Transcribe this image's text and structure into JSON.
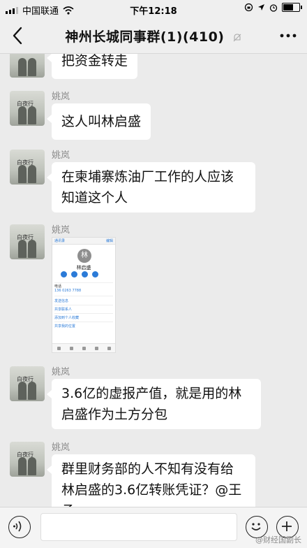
{
  "status_bar": {
    "carrier": "中国联通",
    "time": "下午12:18"
  },
  "nav": {
    "title": "神州长城同事群(1)(410)"
  },
  "avatar_text": "白夜行",
  "messages": [
    {
      "sender": "",
      "text": "把资金转走"
    },
    {
      "sender": "姚岚",
      "text": "这人叫林启盛"
    },
    {
      "sender": "姚岚",
      "lines": [
        "在柬埔寨炼油厂工作的人应该",
        "知道这个人"
      ]
    },
    {
      "sender": "姚岚",
      "type": "image",
      "card": {
        "back": "通讯录",
        "edit": "编辑",
        "initial": "林",
        "name": "林启盛",
        "section": "电话",
        "phone": "136 0263 7788",
        "links": [
          "发送信息",
          "共享联系人",
          "添加到个人收藏",
          "共享我的位置"
        ]
      }
    },
    {
      "sender": "姚岚",
      "lines": [
        "3.6亿的虚报产值，就是用的林",
        "启盛作为土方分包"
      ]
    },
    {
      "sender": "姚岚",
      "lines": [
        "群里财务部的人不知有没有给",
        "林启盛的3.6亿转账凭证？@王",
        "承"
      ]
    }
  ],
  "watermark": "@财经国副长",
  "icons": {
    "voice": "voice-icon",
    "emoji": "emoji-icon",
    "add": "add-icon",
    "back": "back-chevron-icon",
    "more": "more-icon",
    "mute": "mute-bell-icon"
  }
}
